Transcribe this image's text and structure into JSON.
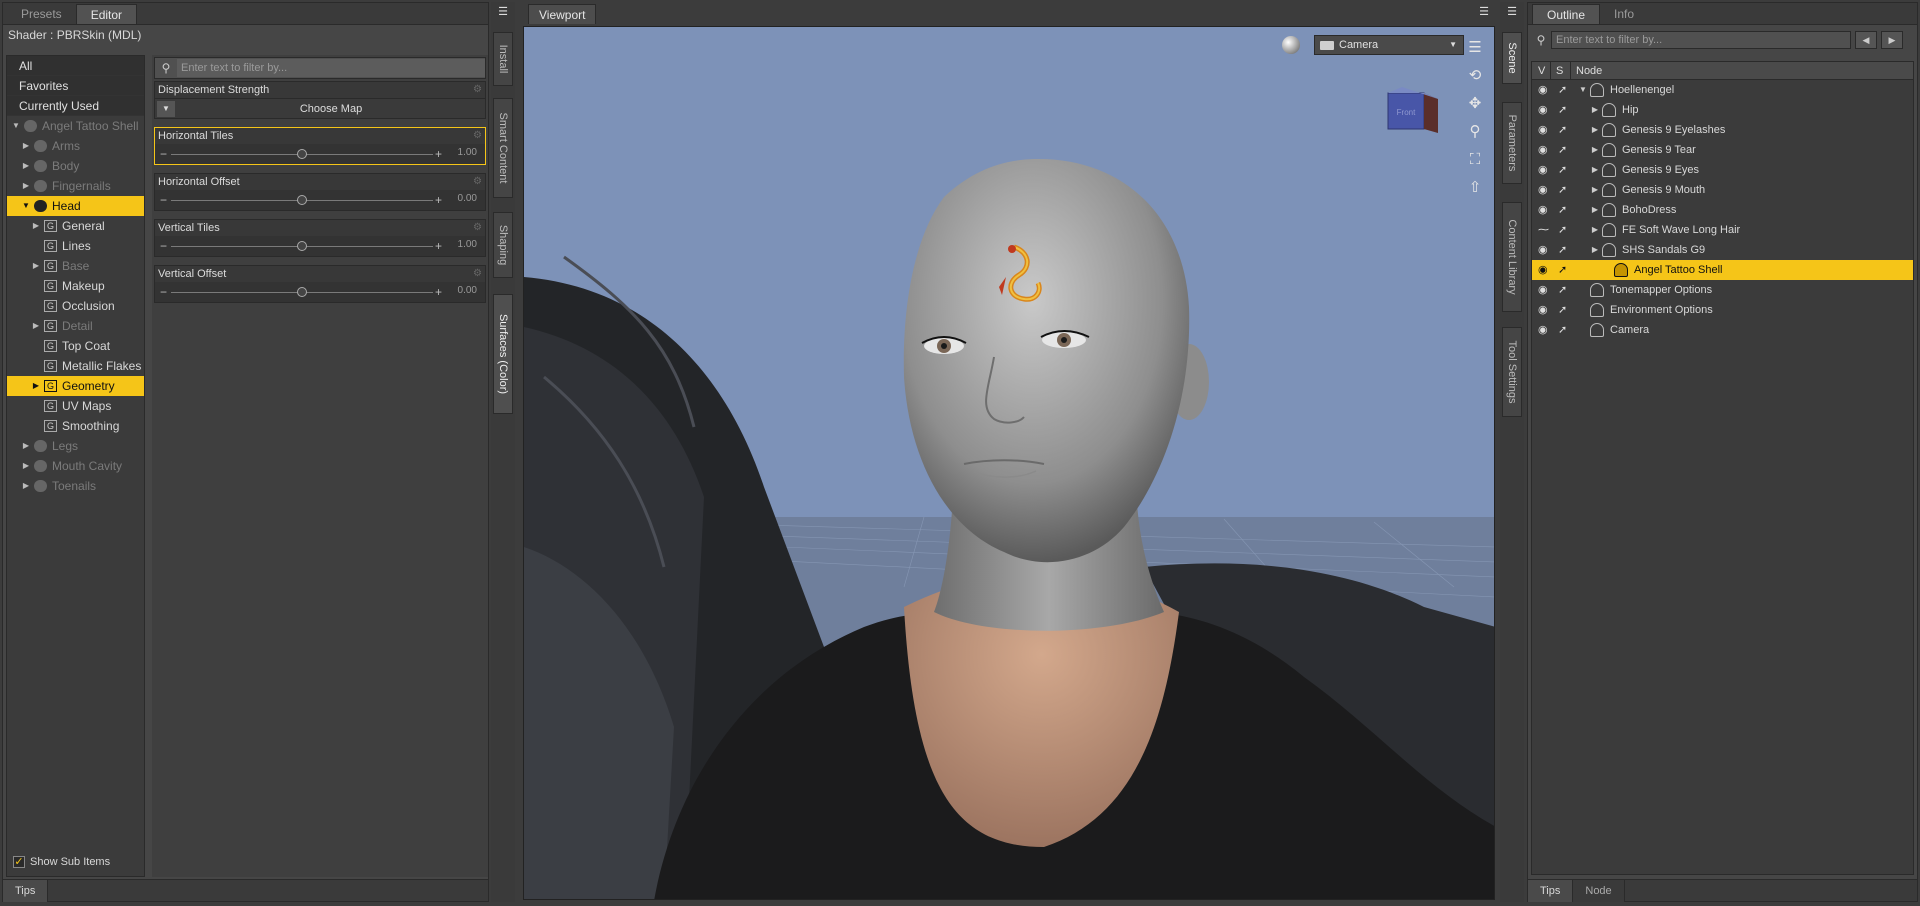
{
  "left_pane": {
    "tabs": [
      "Presets",
      "Editor"
    ],
    "shader_label": "Shader :  PBRSkin (MDL)",
    "filters": [
      "All",
      "Favorites",
      "Currently Used"
    ],
    "tree": [
      {
        "label": "Angel Tattoo Shell",
        "dim": true,
        "icon": "figure-icon",
        "arrow": "▼",
        "indent": 0
      },
      {
        "label": "Arms",
        "dim": true,
        "icon": "figure-icon",
        "arrow": "▶",
        "indent": 1
      },
      {
        "label": "Body",
        "dim": true,
        "icon": "figure-icon",
        "arrow": "▶",
        "indent": 1
      },
      {
        "label": "Fingernails",
        "dim": true,
        "icon": "figure-icon",
        "arrow": "▶",
        "indent": 1
      },
      {
        "label": "Head",
        "selected": true,
        "icon": "figure-icon",
        "arrow": "▼",
        "indent": 1
      },
      {
        "label": "General",
        "icon": "group-icon",
        "arrow": "▶",
        "indent": 2
      },
      {
        "label": "Lines",
        "icon": "group-icon",
        "arrow": "",
        "indent": 2
      },
      {
        "label": "Base",
        "dim": true,
        "icon": "group-icon",
        "arrow": "▶",
        "indent": 2
      },
      {
        "label": "Makeup",
        "icon": "group-icon",
        "arrow": "",
        "indent": 2
      },
      {
        "label": "Occlusion",
        "icon": "group-icon",
        "arrow": "",
        "indent": 2
      },
      {
        "label": "Detail",
        "dim": true,
        "icon": "group-icon",
        "arrow": "▶",
        "indent": 2
      },
      {
        "label": "Top Coat",
        "icon": "group-icon",
        "arrow": "",
        "indent": 2
      },
      {
        "label": "Metallic Flakes",
        "icon": "group-icon",
        "arrow": "",
        "indent": 2
      },
      {
        "label": "Geometry",
        "selected": true,
        "icon": "group-icon",
        "arrow": "▶",
        "indent": 2
      },
      {
        "label": "UV Maps",
        "icon": "group-icon",
        "arrow": "",
        "indent": 2
      },
      {
        "label": "Smoothing",
        "icon": "group-icon",
        "arrow": "",
        "indent": 2
      },
      {
        "label": "Legs",
        "dim": true,
        "icon": "figure-icon",
        "arrow": "▶",
        "indent": 1
      },
      {
        "label": "Mouth Cavity",
        "dim": true,
        "icon": "figure-icon",
        "arrow": "▶",
        "indent": 1
      },
      {
        "label": "Toenails",
        "dim": true,
        "icon": "figure-icon",
        "arrow": "▶",
        "indent": 1
      }
    ],
    "show_sub_items_label": "Show Sub Items",
    "show_sub_items_checked": true,
    "filter_placeholder": "Enter text to filter by...",
    "properties": {
      "displacement": {
        "label": "Displacement Strength",
        "choose_map": "Choose Map"
      },
      "sliders": [
        {
          "label": "Horizontal Tiles",
          "value": "1.00",
          "fraction": 0.5,
          "selected": true
        },
        {
          "label": "Horizontal Offset",
          "value": "0.00",
          "fraction": 0.5
        },
        {
          "label": "Vertical Tiles",
          "value": "1.00",
          "fraction": 0.5
        },
        {
          "label": "Vertical Offset",
          "value": "0.00",
          "fraction": 0.5
        }
      ]
    },
    "tips_tab": "Tips"
  },
  "side_tabs_left": [
    "Install",
    "Smart Content",
    "Shaping",
    "Surfaces (Color)"
  ],
  "viewport": {
    "tab": "Viewport",
    "camera": "Camera",
    "tools": [
      "orbit-icon",
      "pan-icon",
      "zoom-icon",
      "frame-icon",
      "up-icon"
    ],
    "nav_cube_face": "Front"
  },
  "side_tabs_right": [
    "Scene",
    "Parameters",
    "Content Library",
    "Tool Settings"
  ],
  "right_pane": {
    "tabs": [
      "Outline",
      "Info"
    ],
    "filter_placeholder": "Enter text to filter by...",
    "columns": {
      "v": "V",
      "s": "S",
      "node": "Node"
    },
    "nodes": [
      {
        "label": "Hoellenengel",
        "arrow": "▼",
        "indent": 0
      },
      {
        "label": "Hip",
        "arrow": "▶",
        "indent": 1
      },
      {
        "label": "Genesis 9 Eyelashes",
        "arrow": "▶",
        "indent": 1
      },
      {
        "label": "Genesis 9 Tear",
        "arrow": "▶",
        "indent": 1
      },
      {
        "label": "Genesis 9 Eyes",
        "arrow": "▶",
        "indent": 1
      },
      {
        "label": "Genesis 9 Mouth",
        "arrow": "▶",
        "indent": 1
      },
      {
        "label": "BohoDress",
        "arrow": "▶",
        "indent": 1
      },
      {
        "label": "FE Soft Wave Long Hair",
        "arrow": "▶",
        "indent": 1,
        "hidden": true
      },
      {
        "label": "SHS Sandals G9",
        "arrow": "▶",
        "indent": 1
      },
      {
        "label": "Angel Tattoo Shell",
        "arrow": "",
        "indent": 2,
        "selected": true
      },
      {
        "label": "Tonemapper Options",
        "arrow": "",
        "indent": 0
      },
      {
        "label": "Environment Options",
        "arrow": "",
        "indent": 0
      },
      {
        "label": "Camera",
        "arrow": "",
        "indent": 0
      }
    ],
    "bottom_tabs": [
      "Tips",
      "Node"
    ]
  },
  "colors": {
    "accent": "#f5c518",
    "sky": "#7d92b8",
    "panel": "#464646"
  }
}
